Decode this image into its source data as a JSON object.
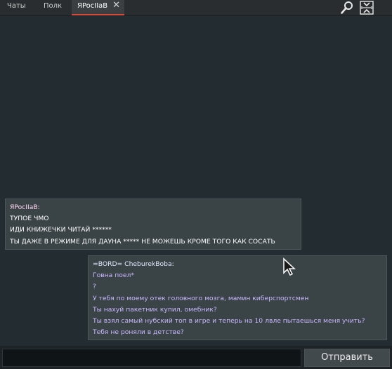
{
  "tabs": [
    {
      "label": "Чаты",
      "active": false
    },
    {
      "label": "Полк",
      "active": false
    },
    {
      "label": "ЯPocIIaB",
      "active": true
    }
  ],
  "icons": {
    "tab_close": "close-icon",
    "search": "search-icon",
    "window_mode": "window-resize-icon"
  },
  "messages": [
    {
      "sender": "ЯPocIIaB:",
      "lines": [
        "ТУПОЕ ЧМО",
        "ИДИ КНИЖЕЧКИ ЧИТАЙ ******",
        "ТЫ ДАЖЕ В РЕЖИМЕ ДЛЯ ДАУНА ***** НЕ МОЖЕШЬ КРОМЕ ТОГО КАК СОСАТЬ"
      ]
    },
    {
      "sender": "=BORD= CheburekBoba:",
      "lines": [
        "Говна поел*",
        "?",
        "У тебя по моему отек головного мозга, мамин киберспортсмен",
        "Ты нахуй пакетник купил, омебник?",
        "Ты взял самый нубский топ в игре и теперь на 10 лвле пытаешься меня учить?",
        "Тебя не роняли в детстве?"
      ]
    }
  ],
  "input": {
    "value": "",
    "placeholder": ""
  },
  "send_label": "Отправить",
  "colors": {
    "background": "#232c30",
    "tab_accent": "#d24a3a",
    "bubble": "#3a4346",
    "own_text": "#ffffff",
    "other_text": "#c9b8ff"
  }
}
